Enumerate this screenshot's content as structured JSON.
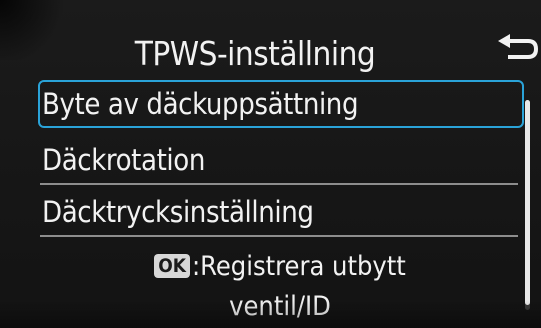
{
  "header": {
    "title": "TPWS-inställning",
    "back_icon": "return-arrow-icon"
  },
  "menu": {
    "items": [
      {
        "label": "Byte av däckuppsättning",
        "selected": true
      },
      {
        "label": "Däckrotation",
        "selected": false
      },
      {
        "label": "Däcktrycksinställning",
        "selected": false
      }
    ]
  },
  "hint": {
    "ok_label": "OK",
    "line1": ":Registrera utbytt",
    "line2": "ventil/ID"
  },
  "colors": {
    "selection_border": "#2aa3d8",
    "text": "#f2f2f2",
    "background": "#161616"
  }
}
